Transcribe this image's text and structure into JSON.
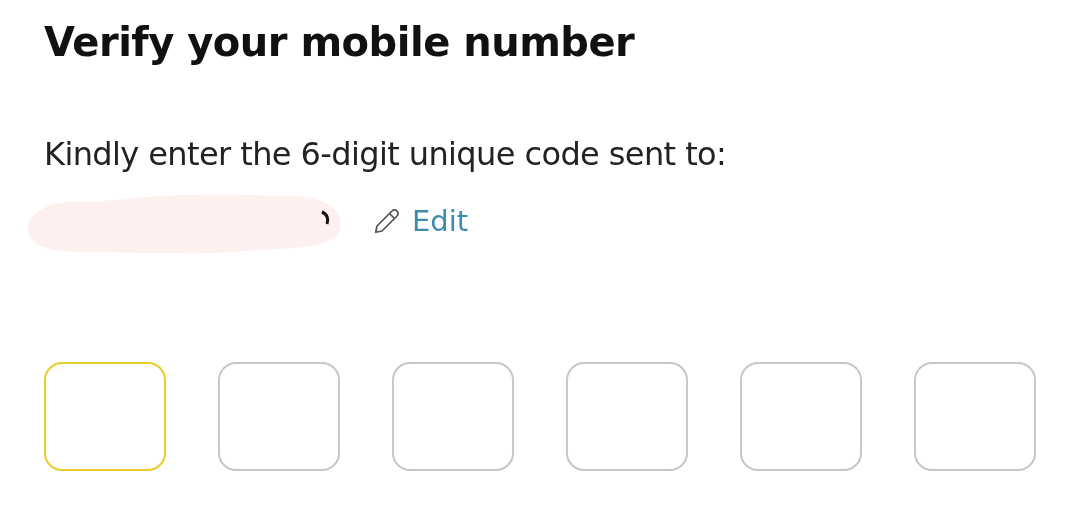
{
  "title": "Verify your mobile number",
  "instruction": "Kindly enter the 6-digit unique code sent to:",
  "edit_link": {
    "label": "Edit"
  },
  "code_boxes": [
    {
      "selected": true
    },
    {
      "selected": false
    },
    {
      "selected": false
    },
    {
      "selected": false
    },
    {
      "selected": false
    },
    {
      "selected": false
    }
  ]
}
